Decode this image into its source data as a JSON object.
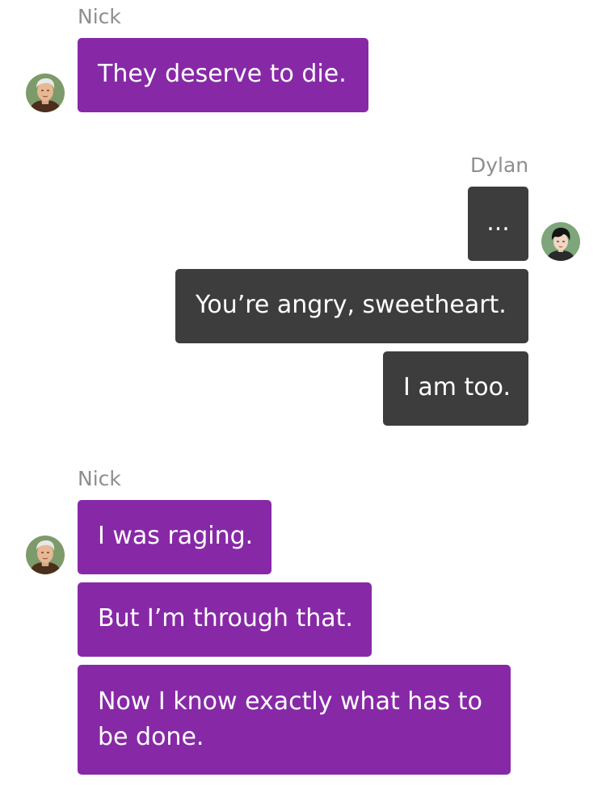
{
  "conversation": {
    "group1": {
      "sender": "Nick",
      "messages": [
        "They deserve to die."
      ]
    },
    "group2": {
      "sender": "Dylan",
      "messages": [
        "...",
        "You’re angry, sweetheart.",
        "I am too."
      ]
    },
    "group3": {
      "sender": "Nick",
      "messages": [
        "I was raging.",
        "But I’m through that.",
        "Now I know exactly what has to be done."
      ]
    }
  },
  "colors": {
    "nick_bubble": "#8729a6",
    "dylan_bubble": "#3d3d3d",
    "sender_label": "#8e8e8e",
    "background": "#ffffff"
  },
  "icons": {
    "nick_avatar": "avatar-nick-icon",
    "dylan_avatar": "avatar-dylan-icon"
  }
}
